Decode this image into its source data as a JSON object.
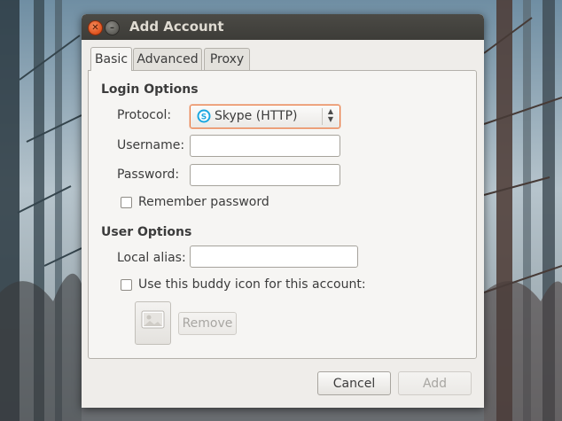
{
  "window": {
    "title": "Add Account"
  },
  "tabs": [
    {
      "label": "Basic",
      "active": true
    },
    {
      "label": "Advanced",
      "active": false
    },
    {
      "label": "Proxy",
      "active": false
    }
  ],
  "login_options": {
    "title": "Login Options",
    "protocol_label": "Protocol:",
    "protocol_value": "Skype (HTTP)",
    "protocol_icon": "skype-icon",
    "username_label": "Username:",
    "username_value": "",
    "password_label": "Password:",
    "password_value": "",
    "remember_password_label": "Remember password",
    "remember_password_checked": false
  },
  "user_options": {
    "title": "User Options",
    "local_alias_label": "Local alias:",
    "local_alias_value": "",
    "buddy_icon_label": "Use this buddy icon for this account:",
    "buddy_icon_checked": false,
    "remove_label": "Remove"
  },
  "actions": {
    "cancel_label": "Cancel",
    "add_label": "Add"
  },
  "colors": {
    "accent": "#e9753c",
    "titlebar": "#3d3c38",
    "close_button": "#e0531e"
  }
}
